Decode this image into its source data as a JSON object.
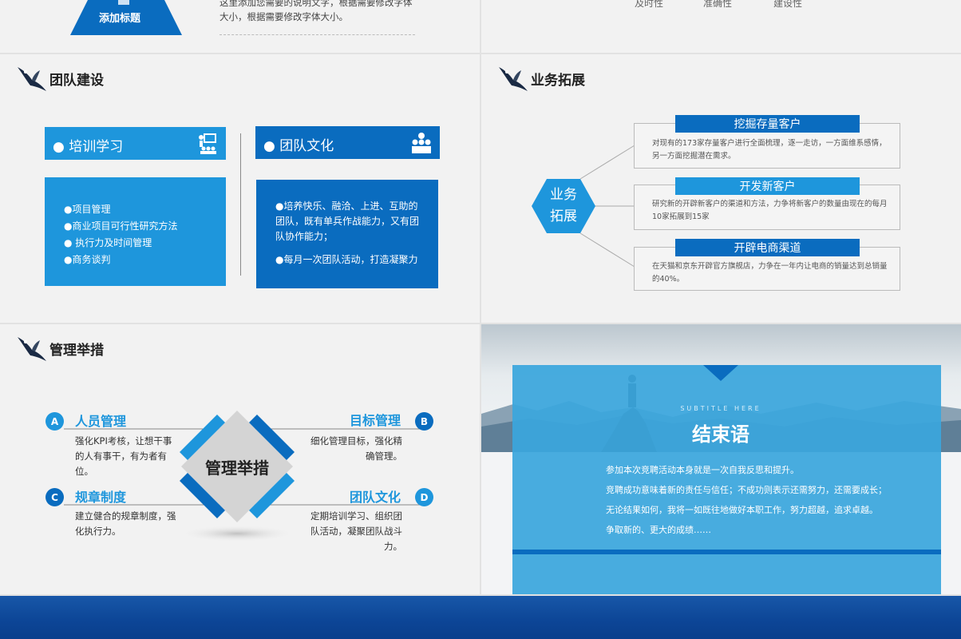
{
  "top_left": {
    "tag_label": "添加标题",
    "desc": "这里添加您需要的说明文字，根据需要修改字体大小，根据需要修改字体大小。"
  },
  "top_right": {
    "labels": [
      "及时性",
      "准确性",
      "建设性"
    ]
  },
  "team": {
    "title": "团队建设",
    "training": {
      "header": "● 培训学习",
      "items": [
        "●项目管理",
        "●商业项目可行性研究方法",
        "● 执行力及时间管理",
        "●商务谈判"
      ]
    },
    "culture": {
      "header": "● 团队文化",
      "items": [
        "●培养快乐、融洽、上进、互助的团队，既有单兵作战能力，又有团队协作能力；",
        "●每月一次团队活动，打造凝聚力"
      ]
    }
  },
  "biz": {
    "title": "业务拓展",
    "hex_line1": "业务",
    "hex_line2": "拓展",
    "items": [
      {
        "title": "挖掘存量客户",
        "text": "对现有的173家存量客户进行全面梳理，逐一走访，一方面维系感情，另一方面挖掘潜在需求。"
      },
      {
        "title": "开发新客户",
        "text": "研究新的开辟新客户的渠道和方法，力争将新客户的数量由现在的每月10家拓展到15家"
      },
      {
        "title": "开辟电商渠道",
        "text": "在天猫和京东开辟官方旗舰店，力争在一年内让电商的销量达到总销量的40%。"
      }
    ]
  },
  "mgmt": {
    "title": "管理举措",
    "center": "管理举措",
    "items": [
      {
        "letter": "A",
        "title": "人员管理",
        "text": "强化KPI考核，让想干事的人有事干，有为者有位。"
      },
      {
        "letter": "B",
        "title": "目标管理",
        "text": "细化管理目标，强化精确管理。"
      },
      {
        "letter": "C",
        "title": "规章制度",
        "text": "建立健合的规章制度，强化执行力。"
      },
      {
        "letter": "D",
        "title": "团队文化",
        "text": "定期培训学习、组织团队活动，凝聚团队战斗力。"
      }
    ]
  },
  "ending": {
    "subtitle": "SUBTITLE HERE",
    "title": "结束语",
    "lines": [
      "参加本次竞聘活动本身就是一次自我反思和提升。",
      "竞聘成功意味着新的责任与信任；不成功则表示还需努力，还需要成长；",
      "无论结果如何，我将一如既往地做好本职工作，努力超越，追求卓越。",
      "争取新的、更大的成绩……"
    ]
  },
  "colors": {
    "primary": "#0a6cbf",
    "light": "#1e96dc",
    "ending_panel": "#3aa6dd"
  }
}
